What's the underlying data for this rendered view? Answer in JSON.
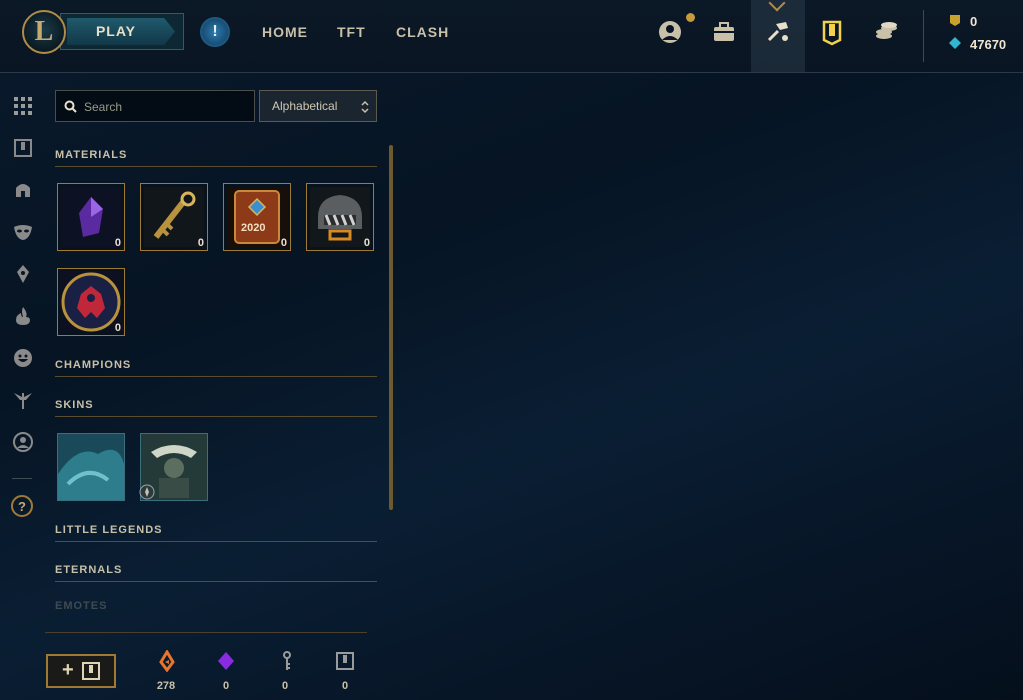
{
  "topnav": {
    "logo": "L",
    "play_label": "PLAY",
    "alert_glyph": "!",
    "items": [
      "HOME",
      "TFT",
      "CLASH"
    ],
    "icons": [
      "profile-icon",
      "collection-bag-icon",
      "crafting-hammer-icon",
      "loot-icon",
      "store-coins-icon"
    ],
    "currency": {
      "rp": "0",
      "be": "47670"
    }
  },
  "sidebar": {
    "icons": [
      "grid-icon",
      "chest-icon",
      "helmet-icon",
      "mask-icon",
      "ward-icon",
      "flame-icon",
      "emote-face-icon",
      "tree-icon",
      "portrait-icon"
    ],
    "help_glyph": "?"
  },
  "search": {
    "placeholder": "Search",
    "value": ""
  },
  "sort": {
    "selected": "Alphabetical"
  },
  "sections": {
    "materials": "MATERIALS",
    "champions": "CHAMPIONS",
    "skins": "SKINS",
    "little_legends": "LITTLE LEGENDS",
    "eternals": "ETERNALS",
    "emotes": "EMOTES"
  },
  "materials": [
    {
      "name": "orange-essence-crystal",
      "count": "0"
    },
    {
      "name": "hextech-key",
      "count": "0"
    },
    {
      "name": "2020-event-pass",
      "count": "0"
    },
    {
      "name": "masterwork-chest",
      "count": "0"
    },
    {
      "name": "worlds-emblem-orb",
      "count": "0"
    }
  ],
  "material_label": {
    "pass_year": "2020"
  },
  "skins": [
    {
      "name": "skin-shard-1"
    },
    {
      "name": "skin-shard-2"
    }
  ],
  "bottom": {
    "values": [
      "278",
      "0",
      "0",
      "0"
    ],
    "icons": [
      "orange-essence-icon",
      "mythic-essence-icon",
      "key-fragment-icon",
      "chest-icon"
    ],
    "add_label": "+"
  },
  "colors": {
    "gold": "#c8aa6e",
    "accent_blue": "#1f5a6c",
    "orange": "#e8752b",
    "purple": "#8a2be2"
  }
}
